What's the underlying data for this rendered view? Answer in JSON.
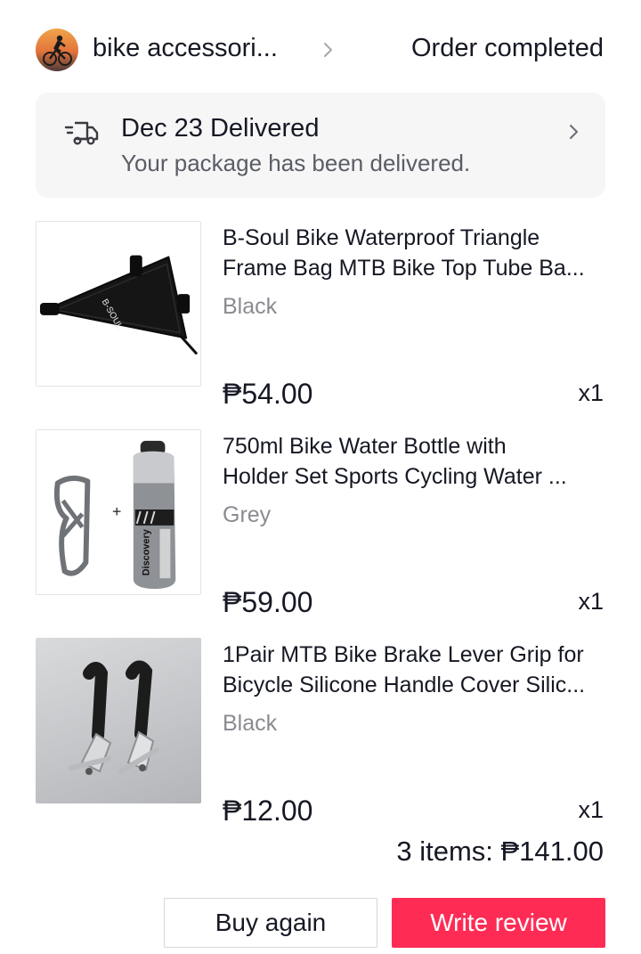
{
  "header": {
    "shop_name": "bike accessori...",
    "order_status": "Order completed"
  },
  "delivery": {
    "title": "Dec 23 Delivered",
    "subtitle": "Your package has been delivered."
  },
  "items": [
    {
      "title_line1": "B-Soul Bike Waterproof Triangle",
      "title_line2": "Frame Bag MTB Bike Top Tube Ba...",
      "variant": "Black",
      "price": "₱54.00",
      "qty": "x1",
      "brand_text": "B-SOUL"
    },
    {
      "title_line1": "750ml Bike Water Bottle with",
      "title_line2": "Holder Set Sports Cycling Water ...",
      "variant": "Grey",
      "price": "₱59.00",
      "qty": "x1",
      "brand_text": "Discovery"
    },
    {
      "title_line1": "1Pair MTB Bike Brake Lever Grip for",
      "title_line2": "Bicycle Silicone Handle Cover Silic...",
      "variant": "Black",
      "price": "₱12.00",
      "qty": "x1"
    }
  ],
  "summary": {
    "total": "3 items: ₱141.00"
  },
  "actions": {
    "buy_again": "Buy again",
    "write_review": "Write review"
  },
  "colors": {
    "accent": "#fe2c55",
    "text": "#161823",
    "muted": "#8a8b91",
    "card_bg": "#f6f6f7"
  }
}
